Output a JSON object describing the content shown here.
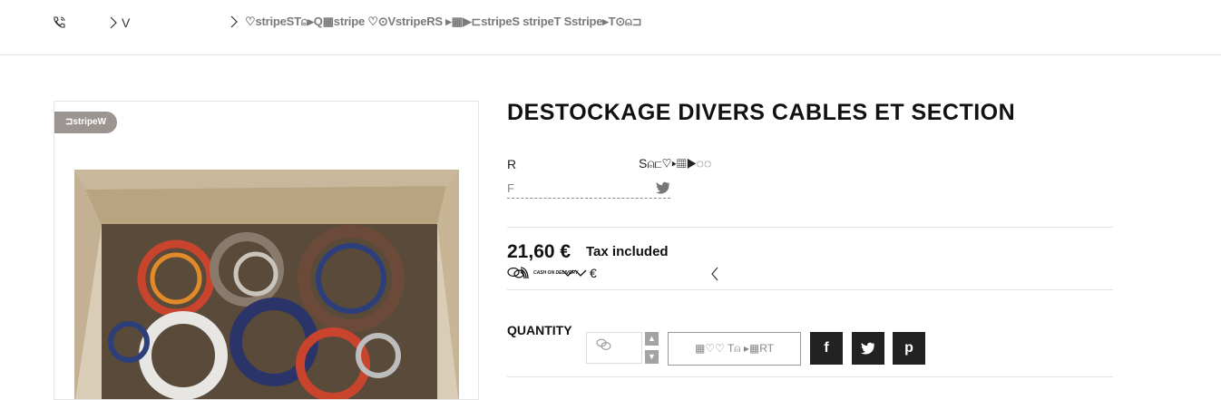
{
  "header": {
    "breadcrumb_1": "V",
    "crumbs_text": "♡stripeST⍝▸Q▦stripe ♡⊙VstripeRS ▸▦▶⊏stripeS stripeT Sstripe▸T⊙⍝⊐"
  },
  "product": {
    "badge": "⊐stripeW",
    "title": "DESTOCKAGE DIVERS CABLES ET SECTION",
    "ref_label": "R",
    "stock_text": "S⍝⊏♡▸▦▶◌◌",
    "share_label": "F",
    "price": "21,60 €",
    "tax_note": "Tax included",
    "cod_text": "CASH ON DELIVERY",
    "pay_suffix": "€",
    "quantity_label": "QUANTITY",
    "add_to_cart": "▦♡♡ T⍝ ▸▦RT"
  },
  "social": [
    {
      "label": "f",
      "icon": "facebook-icon"
    },
    {
      "label": "t",
      "icon": "twitter-icon"
    },
    {
      "label": "p",
      "icon": "pinterest-icon"
    }
  ]
}
